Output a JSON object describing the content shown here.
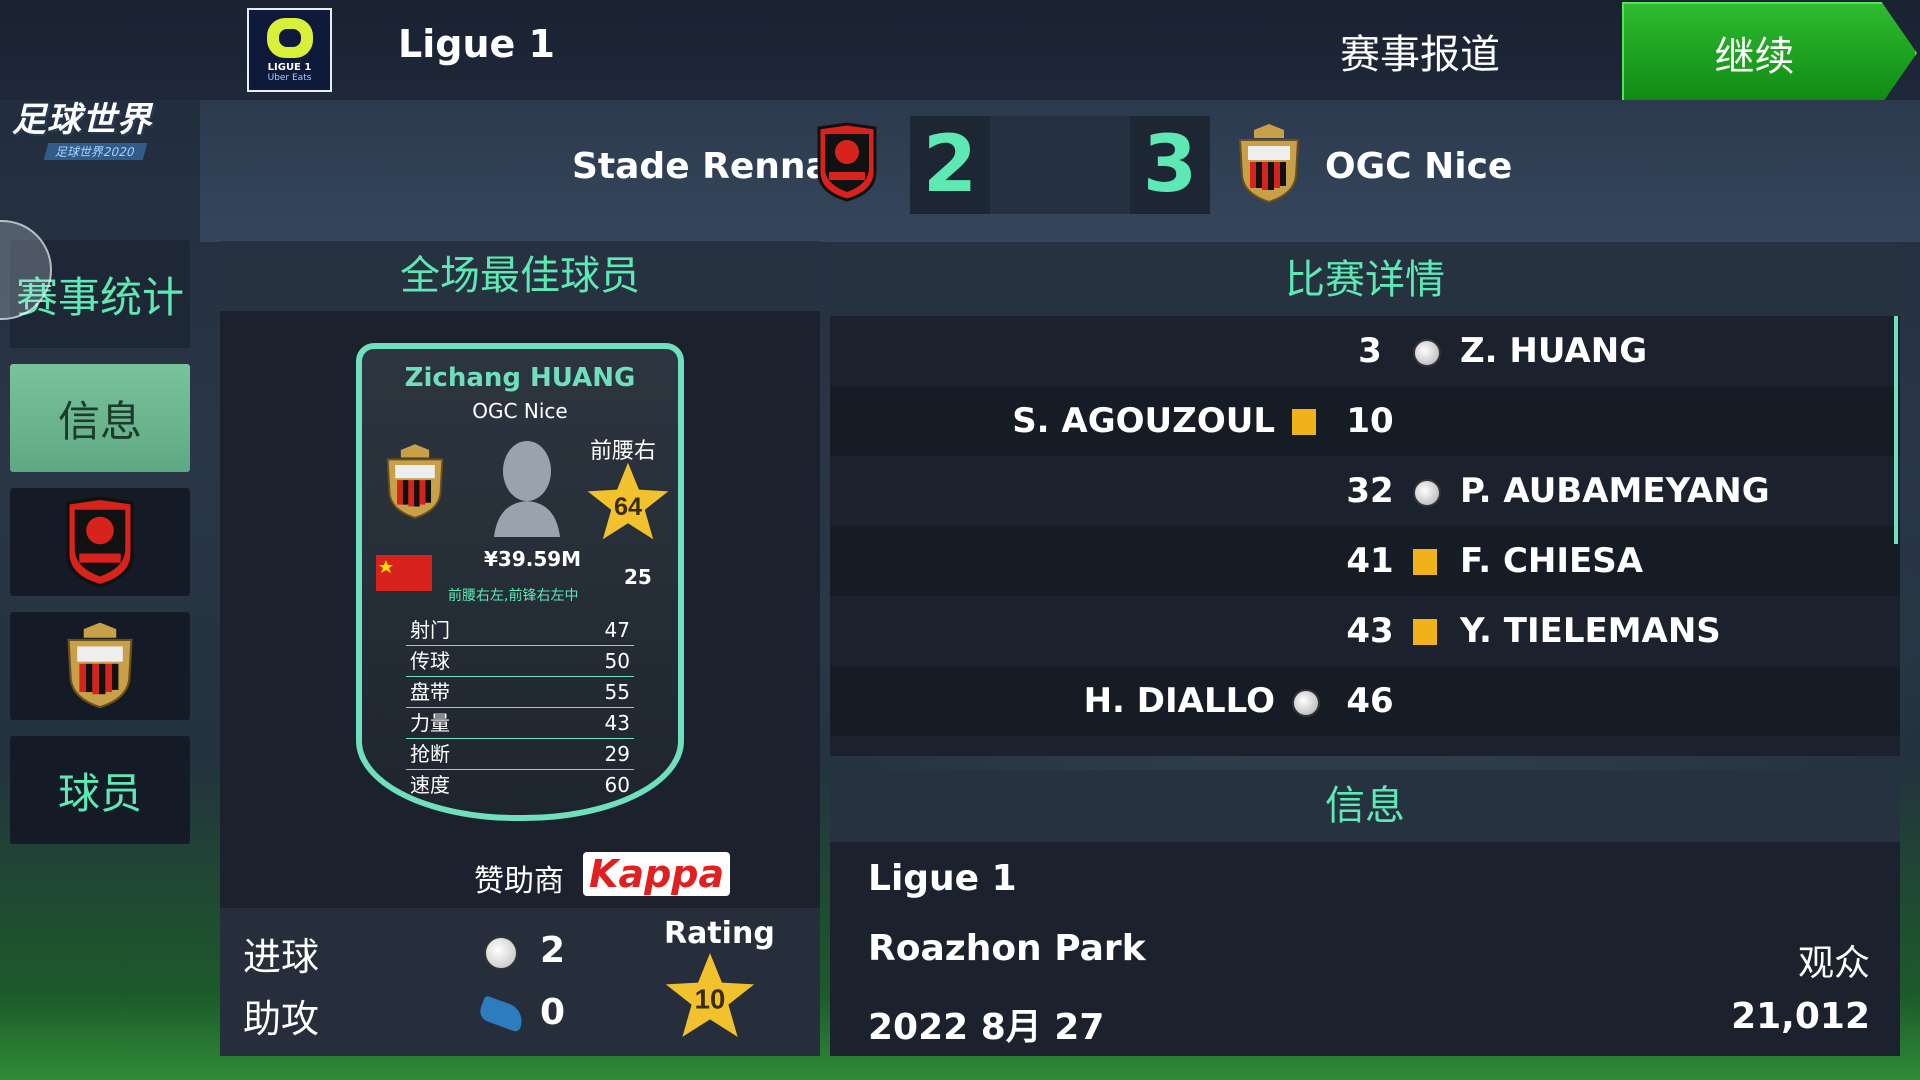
{
  "header": {
    "league_name": "Ligue 1",
    "league_logo_text1": "LIGUE 1",
    "league_logo_text2": "Uber Eats",
    "report_title": "赛事报道",
    "continue_label": "继续",
    "game_logo_main": "足球世界",
    "game_logo_sub": "足球世界2020"
  },
  "scoreboard": {
    "home_team": "Stade Rennais",
    "away_team": "OGC Nice",
    "home_score": "2",
    "away_score": "3"
  },
  "sidebar": {
    "items": [
      {
        "label": "赛事统计"
      },
      {
        "label": "信息"
      },
      {
        "label": "",
        "icon": "rennes-crest-icon"
      },
      {
        "label": "",
        "icon": "nice-crest-icon"
      },
      {
        "label": "球员"
      }
    ]
  },
  "mvp": {
    "title": "全场最佳球员",
    "player_name": "Zichang HUANG",
    "club": "OGC Nice",
    "position": "前腰右",
    "rating": "64",
    "value": "¥39.59M",
    "age": "25",
    "alt_positions": "前腰右左,前锋右左中",
    "stats": [
      {
        "label": "射门",
        "value": "47"
      },
      {
        "label": "传球",
        "value": "50"
      },
      {
        "label": "盘带",
        "value": "55"
      },
      {
        "label": "力量",
        "value": "43"
      },
      {
        "label": "抢断",
        "value": "29"
      },
      {
        "label": "速度",
        "value": "60"
      }
    ],
    "sponsor_label": "赞助商",
    "sponsor_name": "Kappa",
    "goals_label": "进球",
    "goals": "2",
    "assists_label": "助攻",
    "assists": "0",
    "match_rating_label": "Rating",
    "match_rating": "10"
  },
  "match_details": {
    "title": "比赛详情",
    "events": [
      {
        "minute": "3",
        "home": "",
        "away": "Z. HUANG",
        "type": "goal",
        "side": "away"
      },
      {
        "minute": "10",
        "home": "S. AGOUZOUL",
        "away": "",
        "type": "yellow",
        "side": "home"
      },
      {
        "minute": "32",
        "home": "",
        "away": "P. AUBAMEYANG",
        "type": "goal",
        "side": "away"
      },
      {
        "minute": "41",
        "home": "",
        "away": "F. CHIESA",
        "type": "yellow",
        "side": "away"
      },
      {
        "minute": "43",
        "home": "",
        "away": "Y. TIELEMANS",
        "type": "yellow",
        "side": "away"
      },
      {
        "minute": "46",
        "home": "H. DIALLO",
        "away": "",
        "type": "goal",
        "side": "home"
      }
    ]
  },
  "info": {
    "title": "信息",
    "competition": "Ligue 1",
    "stadium": "Roazhon Park",
    "date": "2022 8月 27",
    "attendance_label": "观众",
    "attendance": "21,012"
  },
  "colors": {
    "accent": "#5ee8b3",
    "continue_green": "#1fa51f",
    "yellow_card": "#f0b21a",
    "star_gold": "#f2c12e"
  }
}
